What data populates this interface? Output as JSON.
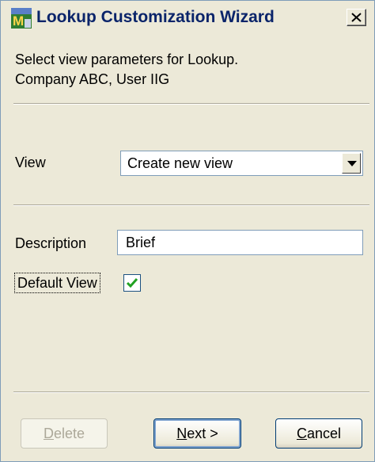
{
  "window": {
    "title": "Lookup Customization Wizard",
    "app_icon": "mas-lookup-app-icon",
    "close_icon": "close-icon"
  },
  "instructions": {
    "line1": "Select view parameters for Lookup.",
    "line2": "Company ABC, User IIG"
  },
  "view": {
    "label": "View",
    "selected": "Create new view",
    "dropdown_icon": "chevron-down-icon"
  },
  "description": {
    "label": "Description",
    "value": "Brief"
  },
  "default_view": {
    "label": "Default View",
    "checked": true,
    "check_icon": "checkmark-icon"
  },
  "buttons": {
    "delete": {
      "mnemonic": "D",
      "rest": "elete",
      "enabled": false
    },
    "next": {
      "mnemonic": "N",
      "rest": "ext >",
      "enabled": true
    },
    "cancel": {
      "mnemonic": "C",
      "rest": "ancel",
      "enabled": true
    }
  },
  "colors": {
    "title_text": "#0a246a",
    "dialog_background": "#ece9d8",
    "checkmark": "#21a121"
  }
}
